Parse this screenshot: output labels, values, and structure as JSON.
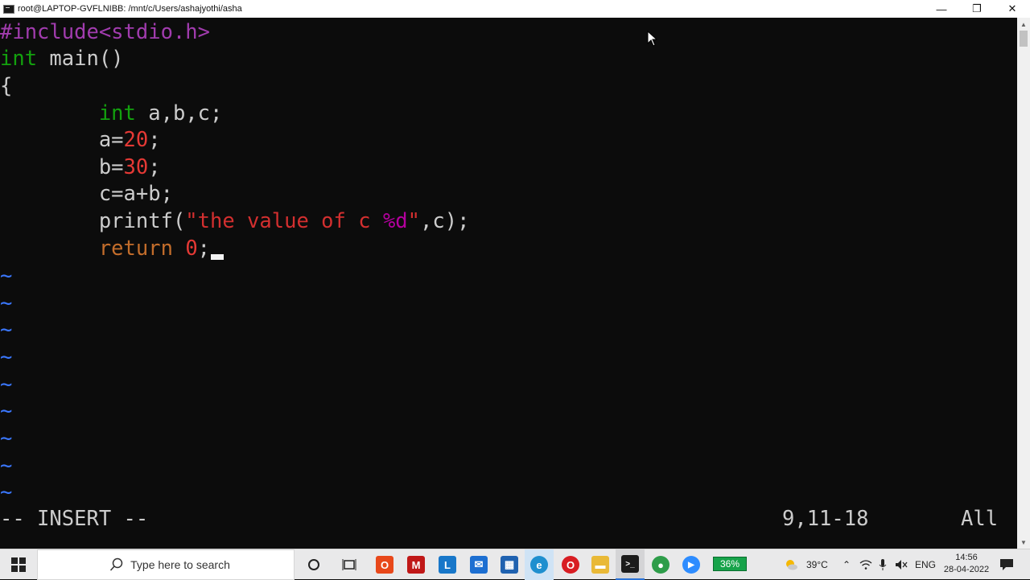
{
  "window": {
    "title": "root@LAPTOP-GVFLNIBB: /mnt/c/Users/ashajyothi/asha",
    "minimize": "—",
    "restore": "❐",
    "close": "✕"
  },
  "editor": {
    "lines": [
      {
        "pp": "#include<stdio.h>"
      },
      {
        "ty": "int",
        "rest": " main()"
      },
      {
        "text": "{"
      },
      {
        "indent": "        ",
        "ty": "int",
        "rest": " a,b,c;"
      },
      {
        "indent": "        ",
        "a": "a=",
        "num": "20",
        "end": ";"
      },
      {
        "indent": "        ",
        "a": "b=",
        "num": "30",
        "end": ";"
      },
      {
        "indent": "        ",
        "text": "c=a+b;"
      },
      {
        "indent": "        ",
        "fn": "printf(",
        "str1": "\"the value of c ",
        "fmt": "%d",
        "str2": "\"",
        "end": ",c);"
      },
      {
        "indent": "        ",
        "kw": "return",
        "sp": " ",
        "num": "0",
        "end": ";"
      }
    ],
    "tilde": "~",
    "mode": "-- INSERT --",
    "position": "9,11-18",
    "scroll": "All"
  },
  "taskbar": {
    "search_placeholder": "Type here to search",
    "battery": "36%",
    "temperature": "39°C",
    "language": "ENG",
    "time": "14:56",
    "date": "28-04-2022",
    "apps": [
      {
        "name": "office-icon",
        "label": "O",
        "color": "#e8481a"
      },
      {
        "name": "mcafee-icon",
        "label": "M",
        "color": "#c01818"
      },
      {
        "name": "lens-icon",
        "label": "L",
        "color": "#1877c9"
      },
      {
        "name": "mail-icon",
        "label": "✉",
        "color": "#1d6fd1"
      },
      {
        "name": "store-icon",
        "label": "▦",
        "color": "#2062b0"
      },
      {
        "name": "edge-icon",
        "label": "e",
        "color": "#1e8fcf"
      },
      {
        "name": "opera-icon",
        "label": "O",
        "color": "#d81d22"
      },
      {
        "name": "file-explorer-icon",
        "label": "▬",
        "color": "#e9b937"
      },
      {
        "name": "terminal-icon",
        "label": ">_",
        "color": "#1b1b1b"
      },
      {
        "name": "chrome-icon",
        "label": "●",
        "color": "#2e9d4a"
      },
      {
        "name": "zoom-icon",
        "label": "▶",
        "color": "#2d8cff"
      }
    ]
  }
}
